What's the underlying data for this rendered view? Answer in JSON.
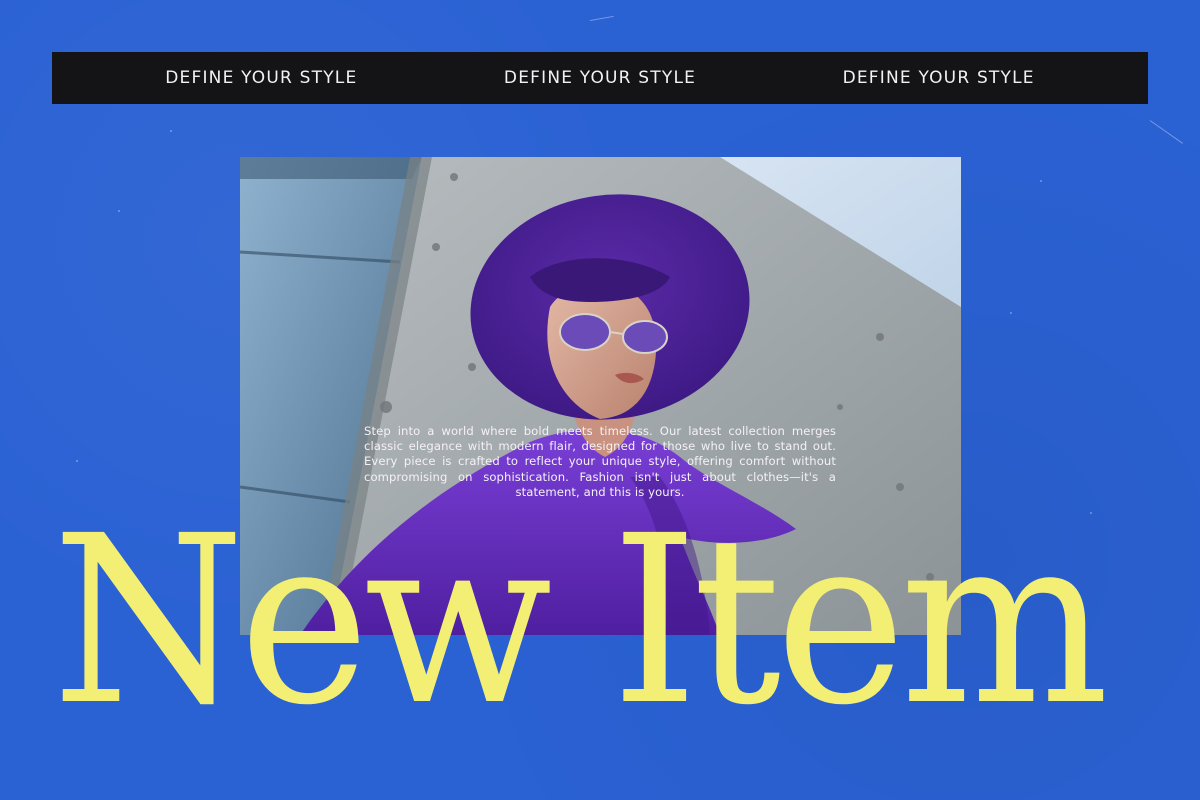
{
  "banner": {
    "items": [
      "DEFINE YOUR STYLE",
      "DEFINE YOUR STYLE",
      "DEFINE YOUR STYLE"
    ]
  },
  "blurb": {
    "text": "Step into a world where bold meets timeless. Our latest collection merges classic elegance with modern flair, designed for those who live to stand out. Every piece is crafted to reflect your unique style, offering comfort without compromising on sophistication. Fashion isn't just about clothes—it's a statement, and this is yours."
  },
  "headline": {
    "text": "New Item"
  },
  "colors": {
    "background": "#2a61d3",
    "banner": "#141417",
    "headline": "#f3ef74",
    "accent_purple": "#5b2aa8"
  }
}
